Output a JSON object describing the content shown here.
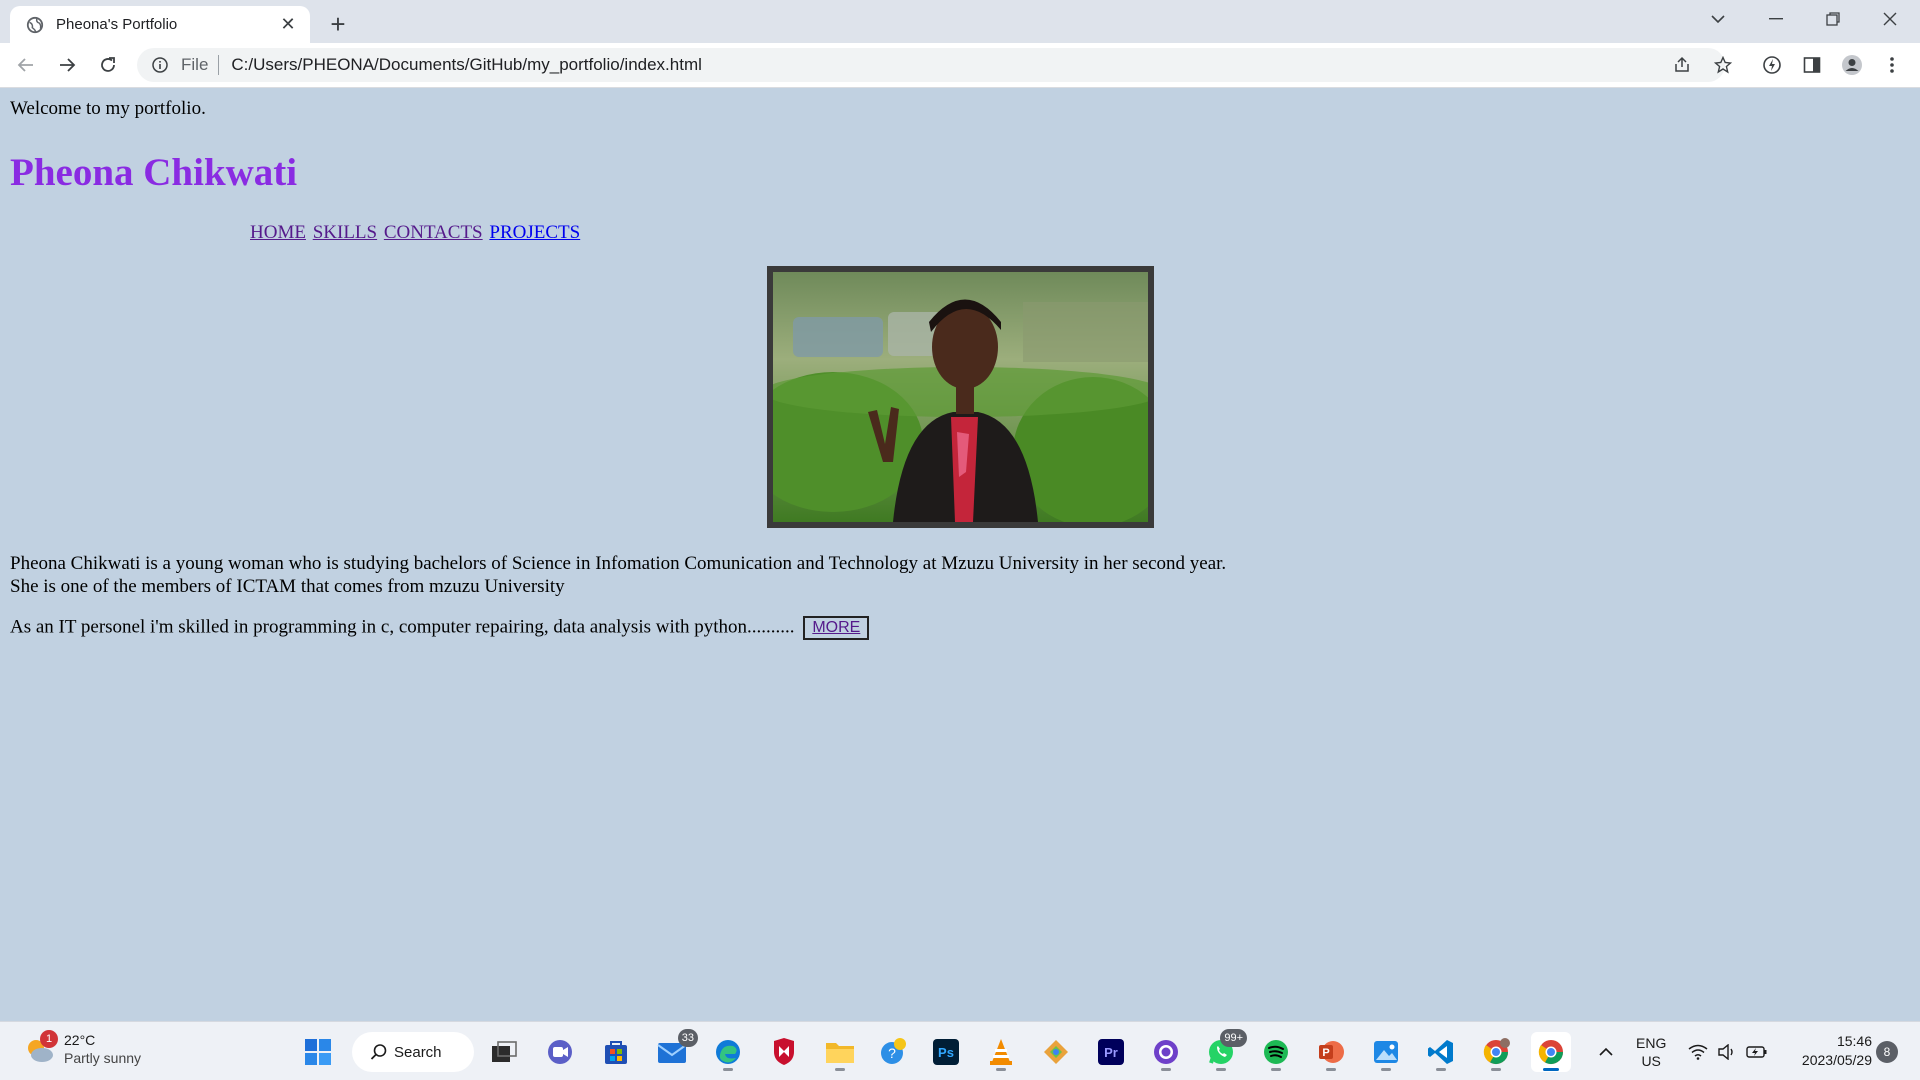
{
  "browser": {
    "tab_title": "Pheona's Portfolio",
    "address_scheme": "File",
    "address_url": "C:/Users/PHEONA/Documents/GitHub/my_portfolio/index.html"
  },
  "page": {
    "welcome": "Welcome to my portfolio.",
    "name": "Pheona Chikwati",
    "nav": [
      "HOME",
      "SKILLS",
      "CONTACTS",
      "PROJECTS"
    ],
    "bio_line1": "Pheona Chikwati is a young woman who is studying bachelors of Science in Infomation Comunication and Technology at Mzuzu University in her second year.",
    "bio_line2": "She is one of the members of ICTAM that comes from mzuzu University",
    "skills_text": "As an IT personel i'm skilled in programming in c, computer repairing, data analysis with python..........",
    "more_label": "MORE"
  },
  "taskbar": {
    "weather_temp": "22°C",
    "weather_desc": "Partly sunny",
    "weather_badge": "1",
    "search_label": "Search",
    "mail_badge": "33",
    "whatsapp_badge": "99+",
    "lang_top": "ENG",
    "lang_bottom": "US",
    "time": "15:46",
    "date": "2023/05/29",
    "notification_count": "8"
  }
}
